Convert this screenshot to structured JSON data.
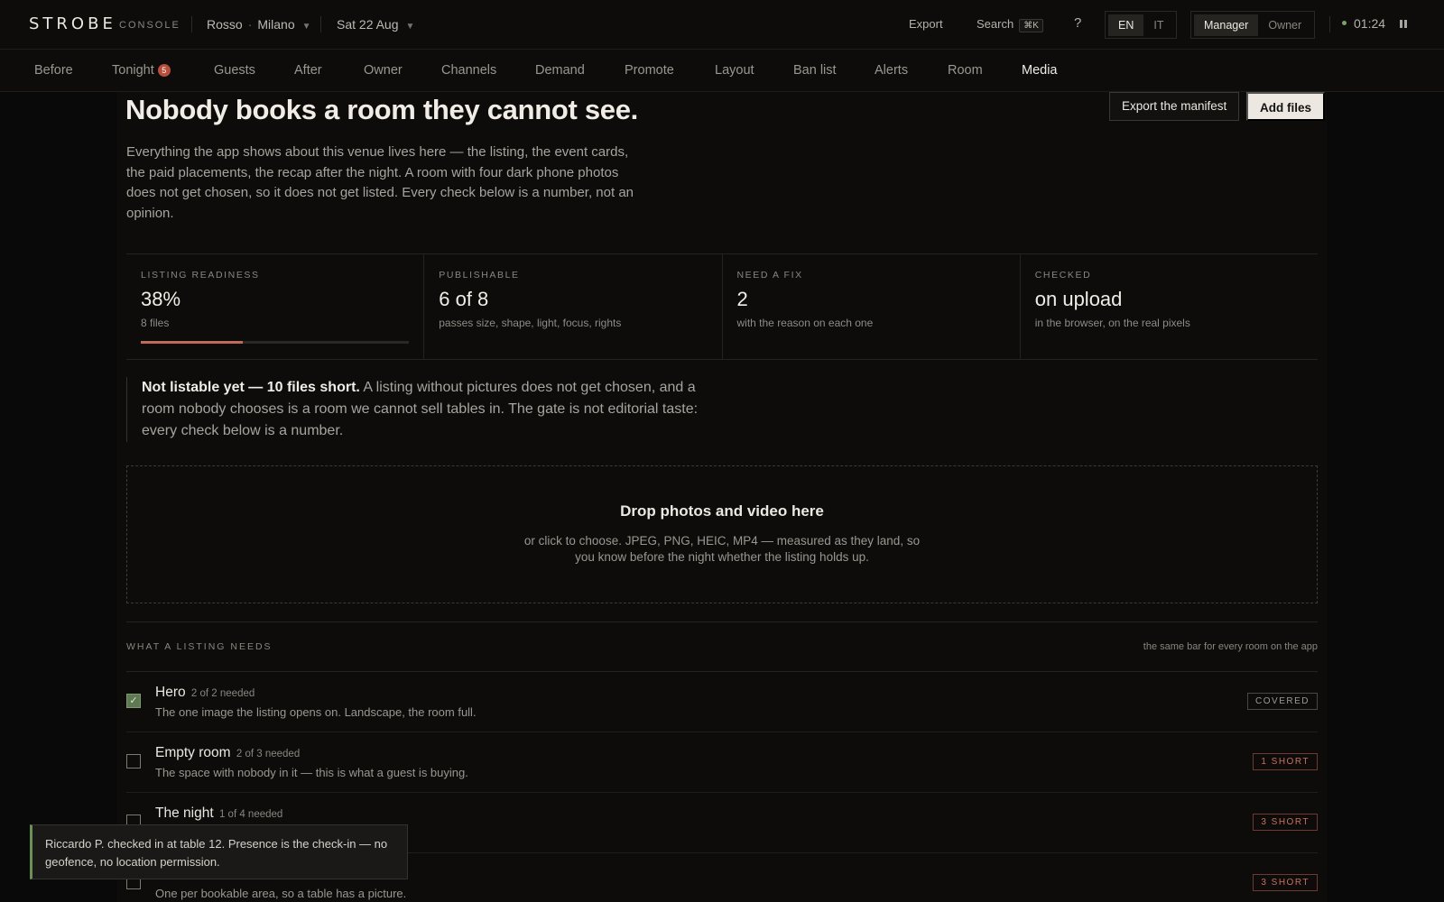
{
  "app": {
    "brand": "STROBE",
    "brand_sub": "CONSOLE"
  },
  "topbar": {
    "venue": "Rosso",
    "city": "Milano",
    "date": "Sat 22 Aug",
    "export": "Export",
    "search": "Search",
    "search_kbd": "⌘K",
    "help": "?",
    "lang_en": "EN",
    "lang_it": "IT",
    "role_manager": "Manager",
    "role_owner": "Owner",
    "clock": "01:24"
  },
  "nav": {
    "tabs": [
      "Before",
      "Tonight",
      "Guests",
      "After",
      "Owner",
      "Channels",
      "Demand",
      "Promote",
      "Layout",
      "Ban list",
      "Alerts",
      "Room",
      "Media"
    ],
    "tonight_badge": "5",
    "active": "Media"
  },
  "page": {
    "title": "Nobody books a room they cannot see.",
    "lede": "Everything the app shows about this venue lives here — the listing, the event cards, the paid placements, the recap after the night. A room with four dark phone photos does not get chosen, so it does not get listed. Every check below is a number, not an opinion.",
    "export_manifest": "Export the manifest",
    "add_files": "Add files"
  },
  "stats": [
    {
      "label": "LISTING READINESS",
      "value": "38%",
      "sub": "8 files",
      "progress": 0.38
    },
    {
      "label": "PUBLISHABLE",
      "value": "6 of 8",
      "sub": "passes size, shape, light, focus, rights"
    },
    {
      "label": "NEED A FIX",
      "value": "2",
      "sub": "with the reason on each one"
    },
    {
      "label": "CHECKED",
      "value": "on upload",
      "sub": "in the browser, on the real pixels"
    }
  ],
  "note": {
    "bold": "Not listable yet — 10 files short.",
    "text": " A listing without pictures does not get chosen, and a room nobody chooses is a room we cannot sell tables in. The gate is not editorial taste: every check below is a number."
  },
  "dropzone": {
    "title": "Drop photos and video here",
    "sub": "or click to choose. JPEG, PNG, HEIC, MP4 — measured as they land, so you know before the night whether the listing holds up."
  },
  "needs": {
    "heading": "WHAT A LISTING NEEDS",
    "aside": "the same bar for every room on the app",
    "rows": [
      {
        "name": "Hero",
        "need": "2 of 2 needed",
        "desc": "The one image the listing opens on. Landscape, the room full.",
        "status": "COVERED",
        "checked": true
      },
      {
        "name": "Empty room",
        "need": "2 of 3 needed",
        "desc": "The space with nobody in it — this is what a guest is buying.",
        "status": "1 SHORT",
        "checked": false
      },
      {
        "name": "The night",
        "need": "1 of 4 needed",
        "desc": "",
        "status": "3 SHORT",
        "checked": false
      },
      {
        "name": "",
        "need": "",
        "desc": "One per bookable area, so a table has a picture.",
        "status": "3 SHORT",
        "checked": false
      }
    ]
  },
  "toast": {
    "text": "Riccardo P. checked in at table 12. Presence is the check-in — no geofence, no location permission."
  },
  "colors": {
    "accent": "#c06a5a",
    "ok": "#6a8f58",
    "badge": "#b84d3c"
  }
}
